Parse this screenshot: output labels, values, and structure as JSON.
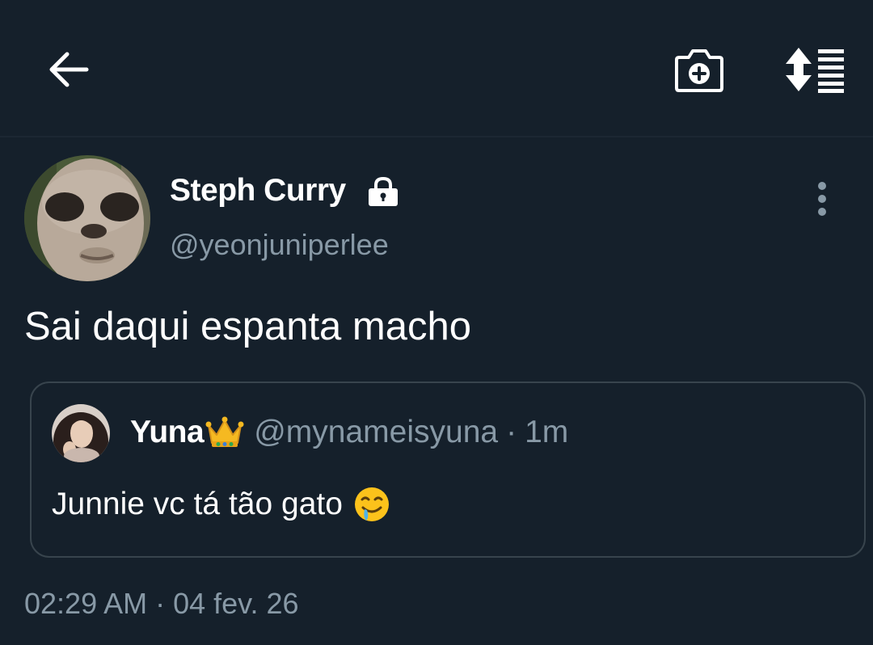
{
  "toolbar": {
    "back_icon": "arrow-left-icon",
    "camera_icon": "camera-add-icon",
    "sort_icon": "sort-list-icon"
  },
  "tweet": {
    "author": {
      "display_name": "Steph Curry",
      "handle": "@yeonjuniperlee",
      "protected_icon": "lock-icon",
      "avatar": "avatar"
    },
    "text": "Sai daqui espanta macho",
    "quoted": {
      "display_name": "Yuna",
      "name_emoji": "crown-icon",
      "handle": "@mynameisyuna",
      "separator": "·",
      "time": "1m",
      "text": "Junnie vc tá tão gato",
      "text_emoji": "drooling-face-icon"
    },
    "timestamp": "02:29 AM · 04 fev. 26"
  },
  "colors": {
    "background": "#15202b",
    "border": "#38444d",
    "secondary_text": "#8899a6",
    "primary_text": "#ffffff"
  }
}
